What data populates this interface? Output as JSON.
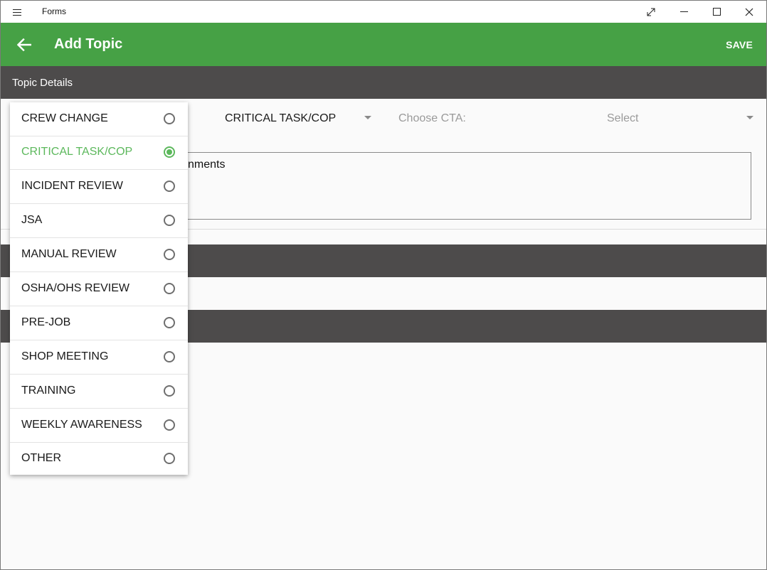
{
  "window": {
    "title": "Forms"
  },
  "appbar": {
    "title": "Add Topic",
    "save_label": "SAVE",
    "color": "#46a145"
  },
  "sections": {
    "topic_details": "Topic Details"
  },
  "form": {
    "topic_type_value": "CRITICAL TASK/COP",
    "cta_label": "Choose CTA:",
    "cta_value": "Select",
    "comments_text": "nments"
  },
  "dropdown": {
    "selected_color": "#5cb85c",
    "items": [
      {
        "label": "CREW CHANGE",
        "selected": false
      },
      {
        "label": "CRITICAL TASK/COP",
        "selected": true
      },
      {
        "label": "INCIDENT REVIEW",
        "selected": false
      },
      {
        "label": "JSA",
        "selected": false
      },
      {
        "label": "MANUAL REVIEW",
        "selected": false
      },
      {
        "label": "OSHA/OHS REVIEW",
        "selected": false
      },
      {
        "label": "PRE-JOB",
        "selected": false
      },
      {
        "label": "SHOP MEETING",
        "selected": false
      },
      {
        "label": "TRAINING",
        "selected": false
      },
      {
        "label": "WEEKLY AWARENESS",
        "selected": false
      },
      {
        "label": "OTHER",
        "selected": false
      }
    ]
  },
  "icons": {
    "menu": "hamburger-icon",
    "back": "arrow-left-icon",
    "expand": "expand-icon",
    "minimize": "minimize-icon",
    "maximize": "maximize-icon",
    "close": "close-icon",
    "caret": "caret-down-icon"
  }
}
